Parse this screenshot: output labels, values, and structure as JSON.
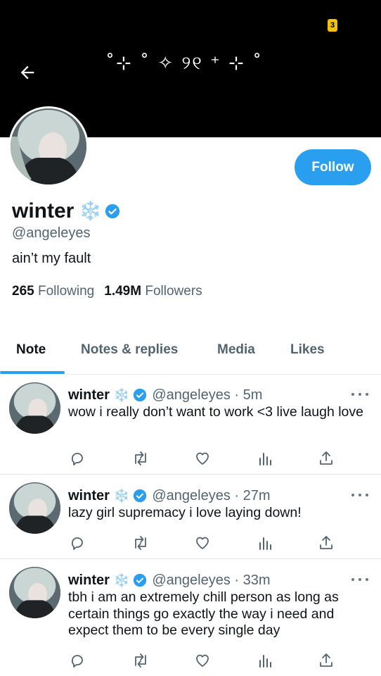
{
  "status_bar": {
    "battery_glyph": "3"
  },
  "banner": {
    "decoration_text": "˚⊹ ˚ ✧ ୨୧ ⁺ ⊹ ˚"
  },
  "profile": {
    "display_name": "winter",
    "name_emoji": "❄️",
    "handle": "@angeleyes",
    "bio": "ain’t my fault",
    "follow_label": "Follow",
    "following_count": "265",
    "following_label": "Following",
    "followers_count": "1.49M",
    "followers_label": "Followers"
  },
  "tabs": [
    {
      "label": "Note",
      "active": true
    },
    {
      "label": "Notes & replies",
      "active": false
    },
    {
      "label": "Media",
      "active": false
    },
    {
      "label": "Likes",
      "active": false
    }
  ],
  "tweets": [
    {
      "name": "winter",
      "emoji": "❄️",
      "handle": "@angeleyes · 5m",
      "text": "wow i really don’t want to work <3 live laugh love"
    },
    {
      "name": "winter",
      "emoji": "❄️",
      "handle": "@angeleyes · 27m",
      "text": "lazy girl supremacy i love laying down!"
    },
    {
      "name": "winter",
      "emoji": "❄️",
      "handle": "@angeleyes · 33m",
      "text": "tbh i am an extremely chill person as long as certain things go exactly the way i need and expect them to be every single day"
    }
  ],
  "icons": {
    "back": "arrow-left-icon",
    "verified": "verified-badge-icon",
    "more": "more-horizontal-icon",
    "reply": "reply-icon",
    "retweet": "retweet-icon",
    "like": "heart-icon",
    "views": "analytics-icon",
    "share": "share-icon"
  },
  "colors": {
    "accent": "#2a9ff0",
    "text_primary": "#0f1419",
    "text_secondary": "#536471",
    "banner": "#000000",
    "snowflake": "#8fd3ff"
  }
}
